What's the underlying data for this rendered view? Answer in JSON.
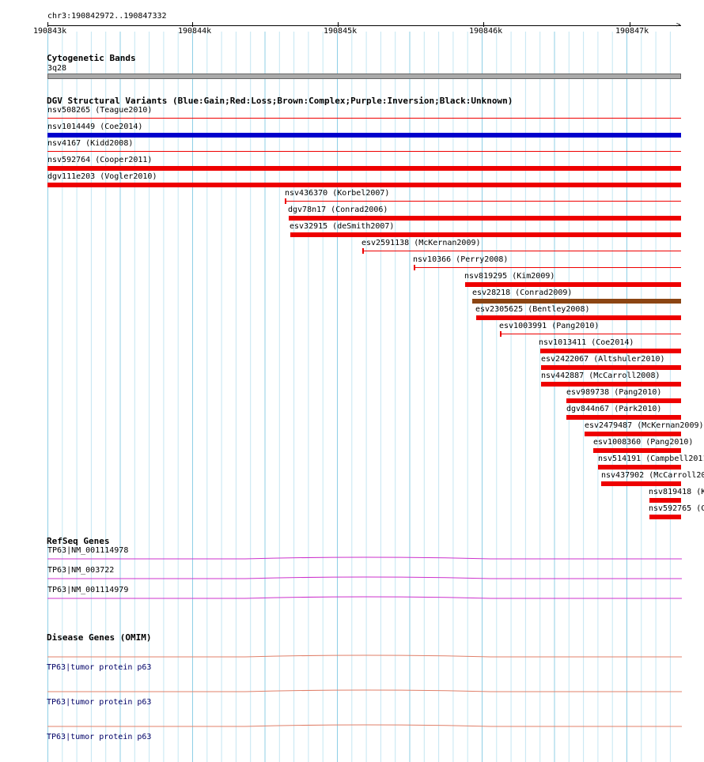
{
  "ruler": {
    "location": "chr3:190842972..190847332",
    "ticks": [
      "190843k",
      "190844k",
      "190845k",
      "190846k",
      "190847k"
    ]
  },
  "cytoband": {
    "title": "Cytogenetic Bands",
    "band": "3q28"
  },
  "dgv": {
    "title": "DGV Structural Variants (Blue:Gain;Red:Loss;Brown:Complex;Purple:Inversion;Black:Unknown)",
    "colors": {
      "loss": "#ee0000",
      "gain": "#0000cc",
      "complex": "#8b4513"
    },
    "variants": [
      {
        "label": "nsv508265 (Teague2010)",
        "type": "loss",
        "thin": true
      },
      {
        "label": "nsv1014449 (Coe2014)",
        "type": "gain",
        "thin": false
      },
      {
        "label": "nsv4167 (Kidd2008)",
        "type": "loss",
        "thin": true
      },
      {
        "label": "nsv592764 (Cooper2011)",
        "type": "loss",
        "thin": false
      },
      {
        "label": "dgv111e203 (Vogler2010)",
        "type": "loss",
        "thin": false
      },
      {
        "label": "nsv436370 (Korbel2007)",
        "type": "loss",
        "thin": true
      },
      {
        "label": "dgv78n17 (Conrad2006)",
        "type": "loss",
        "thin": false
      },
      {
        "label": "esv32915 (deSmith2007)",
        "type": "loss",
        "thin": false
      },
      {
        "label": "esv2591138 (McKernan2009)",
        "type": "loss",
        "thin": true
      },
      {
        "label": "nsv10366 (Perry2008)",
        "type": "loss",
        "thin": true
      },
      {
        "label": "nsv819295 (Kim2009)",
        "type": "loss",
        "thin": false
      },
      {
        "label": "esv28218 (Conrad2009)",
        "type": "complex",
        "thin": false
      },
      {
        "label": "esv2305625 (Bentley2008)",
        "type": "loss",
        "thin": false
      },
      {
        "label": "esv1003991 (Pang2010)",
        "type": "loss",
        "thin": true
      },
      {
        "label": "nsv1013411 (Coe2014)",
        "type": "loss",
        "thin": false
      },
      {
        "label": "esv2422067 (Altshuler2010)",
        "type": "loss",
        "thin": false
      },
      {
        "label": "nsv442887 (McCarroll2008)",
        "type": "loss",
        "thin": false
      },
      {
        "label": "esv989738 (Pang2010)",
        "type": "loss",
        "thin": false
      },
      {
        "label": "dgv844n67 (Park2010)",
        "type": "loss",
        "thin": false
      },
      {
        "label": "esv2479487 (McKernan2009)",
        "type": "loss",
        "thin": false
      },
      {
        "label": "esv1008360 (Pang2010)",
        "type": "loss",
        "thin": false
      },
      {
        "label": "nsv514191 (Campbell2011",
        "type": "loss",
        "thin": false
      },
      {
        "label": "nsv437902 (McCarroll20",
        "type": "loss",
        "thin": false
      },
      {
        "label": "nsv819418 (K",
        "type": "loss",
        "thin": false
      },
      {
        "label": "nsv592765 (C",
        "type": "loss",
        "thin": false
      }
    ]
  },
  "refseq": {
    "title": "RefSeq Genes",
    "genes": [
      "TP63|NM_001114978",
      "TP63|NM_003722",
      "TP63|NM_001114979"
    ]
  },
  "omim": {
    "title": "Disease Genes (OMIM)",
    "genes": [
      "TP63|tumor protein p63",
      "TP63|tumor protein p63",
      "TP63|tumor protein p63"
    ]
  }
}
